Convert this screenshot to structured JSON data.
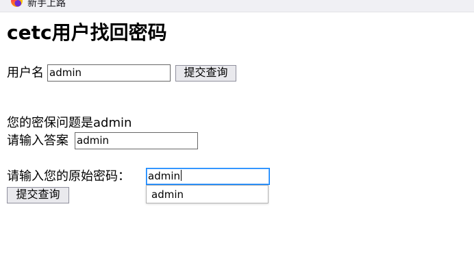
{
  "browser": {
    "tab_title": "新手上路"
  },
  "page": {
    "title": "cetc用户找回密码",
    "username_label": "用户名",
    "username_value": "admin",
    "submit_label": "提交查询",
    "question_text": "您的密保问题是admin",
    "answer_label": "请输入答案",
    "answer_value": "admin",
    "original_password_label": "请输入您的原始密码：",
    "original_password_value": "admin",
    "submit2_label": "提交查询"
  },
  "autocomplete": {
    "items": [
      "admin"
    ]
  }
}
